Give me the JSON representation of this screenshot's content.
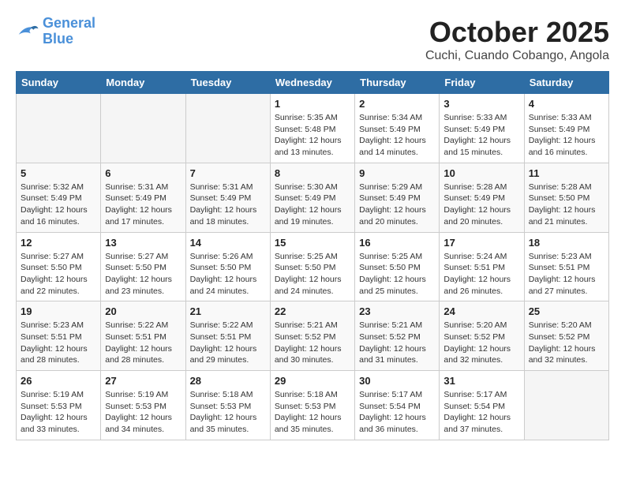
{
  "logo": {
    "line1": "General",
    "line2": "Blue"
  },
  "title": "October 2025",
  "subtitle": "Cuchi, Cuando Cobango, Angola",
  "weekdays": [
    "Sunday",
    "Monday",
    "Tuesday",
    "Wednesday",
    "Thursday",
    "Friday",
    "Saturday"
  ],
  "weeks": [
    [
      {
        "day": "",
        "empty": true
      },
      {
        "day": "",
        "empty": true
      },
      {
        "day": "",
        "empty": true
      },
      {
        "day": "1",
        "sunrise": "5:35 AM",
        "sunset": "5:48 PM",
        "daylight": "12 hours and 13 minutes."
      },
      {
        "day": "2",
        "sunrise": "5:34 AM",
        "sunset": "5:49 PM",
        "daylight": "12 hours and 14 minutes."
      },
      {
        "day": "3",
        "sunrise": "5:33 AM",
        "sunset": "5:49 PM",
        "daylight": "12 hours and 15 minutes."
      },
      {
        "day": "4",
        "sunrise": "5:33 AM",
        "sunset": "5:49 PM",
        "daylight": "12 hours and 16 minutes."
      }
    ],
    [
      {
        "day": "5",
        "sunrise": "5:32 AM",
        "sunset": "5:49 PM",
        "daylight": "12 hours and 16 minutes."
      },
      {
        "day": "6",
        "sunrise": "5:31 AM",
        "sunset": "5:49 PM",
        "daylight": "12 hours and 17 minutes."
      },
      {
        "day": "7",
        "sunrise": "5:31 AM",
        "sunset": "5:49 PM",
        "daylight": "12 hours and 18 minutes."
      },
      {
        "day": "8",
        "sunrise": "5:30 AM",
        "sunset": "5:49 PM",
        "daylight": "12 hours and 19 minutes."
      },
      {
        "day": "9",
        "sunrise": "5:29 AM",
        "sunset": "5:49 PM",
        "daylight": "12 hours and 20 minutes."
      },
      {
        "day": "10",
        "sunrise": "5:28 AM",
        "sunset": "5:49 PM",
        "daylight": "12 hours and 20 minutes."
      },
      {
        "day": "11",
        "sunrise": "5:28 AM",
        "sunset": "5:50 PM",
        "daylight": "12 hours and 21 minutes."
      }
    ],
    [
      {
        "day": "12",
        "sunrise": "5:27 AM",
        "sunset": "5:50 PM",
        "daylight": "12 hours and 22 minutes."
      },
      {
        "day": "13",
        "sunrise": "5:27 AM",
        "sunset": "5:50 PM",
        "daylight": "12 hours and 23 minutes."
      },
      {
        "day": "14",
        "sunrise": "5:26 AM",
        "sunset": "5:50 PM",
        "daylight": "12 hours and 24 minutes."
      },
      {
        "day": "15",
        "sunrise": "5:25 AM",
        "sunset": "5:50 PM",
        "daylight": "12 hours and 24 minutes."
      },
      {
        "day": "16",
        "sunrise": "5:25 AM",
        "sunset": "5:50 PM",
        "daylight": "12 hours and 25 minutes."
      },
      {
        "day": "17",
        "sunrise": "5:24 AM",
        "sunset": "5:51 PM",
        "daylight": "12 hours and 26 minutes."
      },
      {
        "day": "18",
        "sunrise": "5:23 AM",
        "sunset": "5:51 PM",
        "daylight": "12 hours and 27 minutes."
      }
    ],
    [
      {
        "day": "19",
        "sunrise": "5:23 AM",
        "sunset": "5:51 PM",
        "daylight": "12 hours and 28 minutes."
      },
      {
        "day": "20",
        "sunrise": "5:22 AM",
        "sunset": "5:51 PM",
        "daylight": "12 hours and 28 minutes."
      },
      {
        "day": "21",
        "sunrise": "5:22 AM",
        "sunset": "5:51 PM",
        "daylight": "12 hours and 29 minutes."
      },
      {
        "day": "22",
        "sunrise": "5:21 AM",
        "sunset": "5:52 PM",
        "daylight": "12 hours and 30 minutes."
      },
      {
        "day": "23",
        "sunrise": "5:21 AM",
        "sunset": "5:52 PM",
        "daylight": "12 hours and 31 minutes."
      },
      {
        "day": "24",
        "sunrise": "5:20 AM",
        "sunset": "5:52 PM",
        "daylight": "12 hours and 32 minutes."
      },
      {
        "day": "25",
        "sunrise": "5:20 AM",
        "sunset": "5:52 PM",
        "daylight": "12 hours and 32 minutes."
      }
    ],
    [
      {
        "day": "26",
        "sunrise": "5:19 AM",
        "sunset": "5:53 PM",
        "daylight": "12 hours and 33 minutes."
      },
      {
        "day": "27",
        "sunrise": "5:19 AM",
        "sunset": "5:53 PM",
        "daylight": "12 hours and 34 minutes."
      },
      {
        "day": "28",
        "sunrise": "5:18 AM",
        "sunset": "5:53 PM",
        "daylight": "12 hours and 35 minutes."
      },
      {
        "day": "29",
        "sunrise": "5:18 AM",
        "sunset": "5:53 PM",
        "daylight": "12 hours and 35 minutes."
      },
      {
        "day": "30",
        "sunrise": "5:17 AM",
        "sunset": "5:54 PM",
        "daylight": "12 hours and 36 minutes."
      },
      {
        "day": "31",
        "sunrise": "5:17 AM",
        "sunset": "5:54 PM",
        "daylight": "12 hours and 37 minutes."
      },
      {
        "day": "",
        "empty": true
      }
    ]
  ]
}
